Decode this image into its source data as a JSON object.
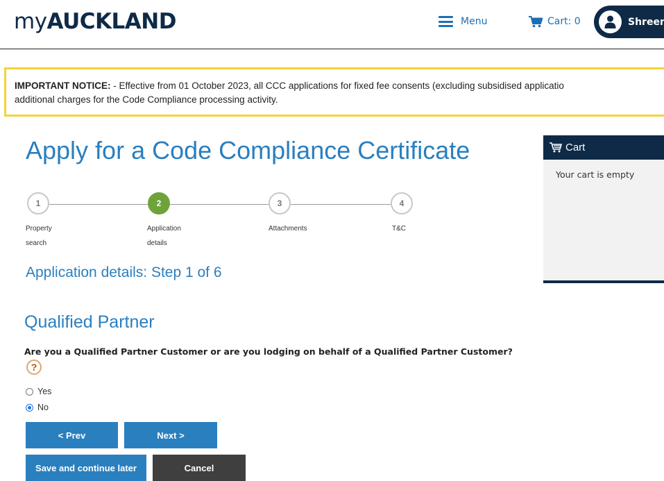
{
  "header": {
    "logo_light": "my",
    "logo_bold": "AUCKLAND",
    "menu_label": "Menu",
    "cart_label": "Cart: 0",
    "user_name": "Shreen"
  },
  "notice": {
    "label": "IMPORTANT NOTICE:",
    "line1": " - Effective from 01 October 2023, all CCC applications for fixed fee consents (excluding subsidised applicatio",
    "line2": "additional charges for the Code Compliance processing activity."
  },
  "page": {
    "title": "Apply for a Code Compliance Certificate",
    "subtitle": "Application details: Step 1 of 6",
    "section_title": "Qualified Partner",
    "question": "Are you a Qualified Partner Customer or are you lodging on behalf of a Qualified Partner Customer?",
    "help_icon_glyph": "?"
  },
  "stepper": {
    "steps": [
      {
        "number": "1",
        "label_line1": "Property",
        "label_line2": "search",
        "active": false
      },
      {
        "number": "2",
        "label_line1": "Application",
        "label_line2": "details",
        "active": true
      },
      {
        "number": "3",
        "label_line1": "Attachments",
        "label_line2": "",
        "active": false
      },
      {
        "number": "4",
        "label_line1": "T&C",
        "label_line2": "",
        "active": false
      }
    ],
    "active_color": "#6ea33a"
  },
  "options": [
    {
      "label": "Yes",
      "checked": false
    },
    {
      "label": "No",
      "checked": true
    }
  ],
  "buttons": {
    "prev": "< Prev",
    "next": "Next >",
    "save": "Save and continue later",
    "cancel": "Cancel"
  },
  "cart_panel": {
    "title": "Cart",
    "empty_text": "Your cart is empty"
  },
  "colors": {
    "brand_navy": "#0e2a47",
    "accent_blue": "#2a7fbf",
    "notice_border": "#f5d33a",
    "cancel_gray": "#3f3f3f"
  },
  "icons": {
    "menu": "hamburger-icon",
    "cart": "cart-icon",
    "user": "user-icon",
    "help": "help-icon",
    "cart_panel": "cart-icon"
  }
}
